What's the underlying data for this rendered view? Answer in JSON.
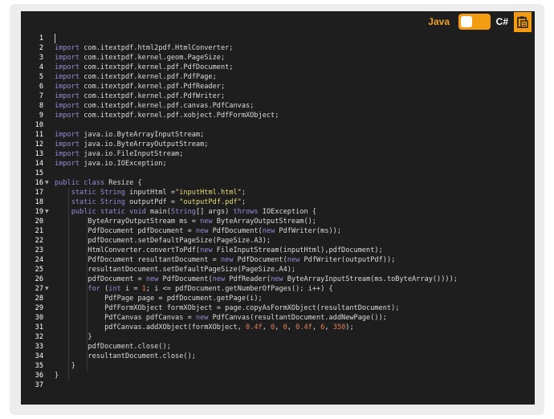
{
  "toolbar": {
    "java_label": "Java",
    "csharp_label": "C#",
    "copy_icon": "clipboard-icon"
  },
  "colors": {
    "accent": "#f39c12",
    "background": "#1e1e1e",
    "plain": "#dcdcdc",
    "keyword": "#9b8ad6",
    "string": "#e6db74",
    "number": "#e67e5a",
    "gutter": "#ffffff"
  },
  "code": {
    "lines": [
      [],
      [
        [
          "k",
          "import"
        ],
        [
          "p",
          " com.itextpdf.html2pdf.HtmlConverter;"
        ]
      ],
      [
        [
          "k",
          "import"
        ],
        [
          "p",
          " com.itextpdf.kernel.geom.PageSize;"
        ]
      ],
      [
        [
          "k",
          "import"
        ],
        [
          "p",
          " com.itextpdf.kernel.pdf.PdfDocument;"
        ]
      ],
      [
        [
          "k",
          "import"
        ],
        [
          "p",
          " com.itextpdf.kernel.pdf.PdfPage;"
        ]
      ],
      [
        [
          "k",
          "import"
        ],
        [
          "p",
          " com.itextpdf.kernel.pdf.PdfReader;"
        ]
      ],
      [
        [
          "k",
          "import"
        ],
        [
          "p",
          " com.itextpdf.kernel.pdf.PdfWriter;"
        ]
      ],
      [
        [
          "k",
          "import"
        ],
        [
          "p",
          " com.itextpdf.kernel.pdf.canvas.PdfCanvas;"
        ]
      ],
      [
        [
          "k",
          "import"
        ],
        [
          "p",
          " com.itextpdf.kernel.pdf.xobject.PdfFormXObject;"
        ]
      ],
      [],
      [
        [
          "k",
          "import"
        ],
        [
          "p",
          " java.io.ByteArrayInputStream;"
        ]
      ],
      [
        [
          "k",
          "import"
        ],
        [
          "p",
          " java.io.ByteArrayOutputStream;"
        ]
      ],
      [
        [
          "k",
          "import"
        ],
        [
          "p",
          " java.io.FileInputStream;"
        ]
      ],
      [
        [
          "k",
          "import"
        ],
        [
          "p",
          " java.io.IOException;"
        ]
      ],
      [],
      [
        [
          "k",
          "public"
        ],
        [
          "p",
          " "
        ],
        [
          "k",
          "class"
        ],
        [
          "p",
          " Resize {"
        ]
      ],
      [
        [
          "p",
          "    "
        ],
        [
          "k",
          "static"
        ],
        [
          "p",
          " "
        ],
        [
          "k",
          "String"
        ],
        [
          "p",
          " inputHtml ="
        ],
        [
          "s",
          "\"inputHtml.html\""
        ],
        [
          "p",
          ";"
        ]
      ],
      [
        [
          "p",
          "    "
        ],
        [
          "k",
          "static"
        ],
        [
          "p",
          " "
        ],
        [
          "k",
          "String"
        ],
        [
          "p",
          " outputPdf = "
        ],
        [
          "s",
          "\"outputPdf.pdf\""
        ],
        [
          "p",
          ";"
        ]
      ],
      [
        [
          "p",
          "    "
        ],
        [
          "k",
          "public"
        ],
        [
          "p",
          " "
        ],
        [
          "k",
          "static"
        ],
        [
          "p",
          " "
        ],
        [
          "k",
          "void"
        ],
        [
          "p",
          " main("
        ],
        [
          "k",
          "String"
        ],
        [
          "p",
          "[] args) "
        ],
        [
          "k",
          "throws"
        ],
        [
          "p",
          " IOException {"
        ]
      ],
      [
        [
          "p",
          "        ByteArrayOutputStream ms = "
        ],
        [
          "k",
          "new"
        ],
        [
          "p",
          " ByteArrayOutputStream();"
        ]
      ],
      [
        [
          "p",
          "        PdfDocument pdfDocument = "
        ],
        [
          "k",
          "new"
        ],
        [
          "p",
          " PdfDocument("
        ],
        [
          "k",
          "new"
        ],
        [
          "p",
          " PdfWriter(ms));"
        ]
      ],
      [
        [
          "p",
          "        pdfDocument.setDefaultPageSize(PageSize.A3);"
        ]
      ],
      [
        [
          "p",
          "        HtmlConverter.convertToPdf("
        ],
        [
          "k",
          "new"
        ],
        [
          "p",
          " FileInputStream(inputHtml),pdfDocument);"
        ]
      ],
      [
        [
          "p",
          "        PdfDocument resultantDocument = "
        ],
        [
          "k",
          "new"
        ],
        [
          "p",
          " PdfDocument("
        ],
        [
          "k",
          "new"
        ],
        [
          "p",
          " PdfWriter(outputPdf));"
        ]
      ],
      [
        [
          "p",
          "        resultantDocument.setDefaultPageSize(PageSize.A4);"
        ]
      ],
      [
        [
          "p",
          "        pdfDocument = "
        ],
        [
          "k",
          "new"
        ],
        [
          "p",
          " PdfDocument("
        ],
        [
          "k",
          "new"
        ],
        [
          "p",
          " PdfReader("
        ],
        [
          "k",
          "new"
        ],
        [
          "p",
          " ByteArrayInputStream(ms.toByteArray())));"
        ]
      ],
      [
        [
          "p",
          "        "
        ],
        [
          "k",
          "for"
        ],
        [
          "p",
          " ("
        ],
        [
          "k",
          "int"
        ],
        [
          "p",
          " i = "
        ],
        [
          "n",
          "1"
        ],
        [
          "p",
          "; i <= pdfDocument.getNumberOfPages(); i++) {"
        ]
      ],
      [
        [
          "p",
          "            PdfPage page = pdfDocument.getPage(i);"
        ]
      ],
      [
        [
          "p",
          "            PdfFormXObject formXObject = page.copyAsFormXObject(resultantDocument);"
        ]
      ],
      [
        [
          "p",
          "            PdfCanvas pdfCanvas = "
        ],
        [
          "k",
          "new"
        ],
        [
          "p",
          " PdfCanvas(resultantDocument.addNewPage());"
        ]
      ],
      [
        [
          "p",
          "            pdfCanvas.addXObject(formXObject, "
        ],
        [
          "n",
          "0.4f"
        ],
        [
          "p",
          ", "
        ],
        [
          "n",
          "0"
        ],
        [
          "p",
          ", "
        ],
        [
          "n",
          "0"
        ],
        [
          "p",
          ", "
        ],
        [
          "n",
          "0.4f"
        ],
        [
          "p",
          ", "
        ],
        [
          "n",
          "6"
        ],
        [
          "p",
          ", "
        ],
        [
          "n",
          "350"
        ],
        [
          "p",
          ");"
        ]
      ],
      [
        [
          "p",
          "        }"
        ]
      ],
      [
        [
          "p",
          "        pdfDocument.close();"
        ]
      ],
      [
        [
          "p",
          "        resultantDocument.close();"
        ]
      ],
      [
        [
          "p",
          "    }"
        ]
      ],
      [
        [
          "p",
          "}"
        ]
      ],
      []
    ],
    "fold_lines": [
      16,
      19,
      27
    ]
  }
}
